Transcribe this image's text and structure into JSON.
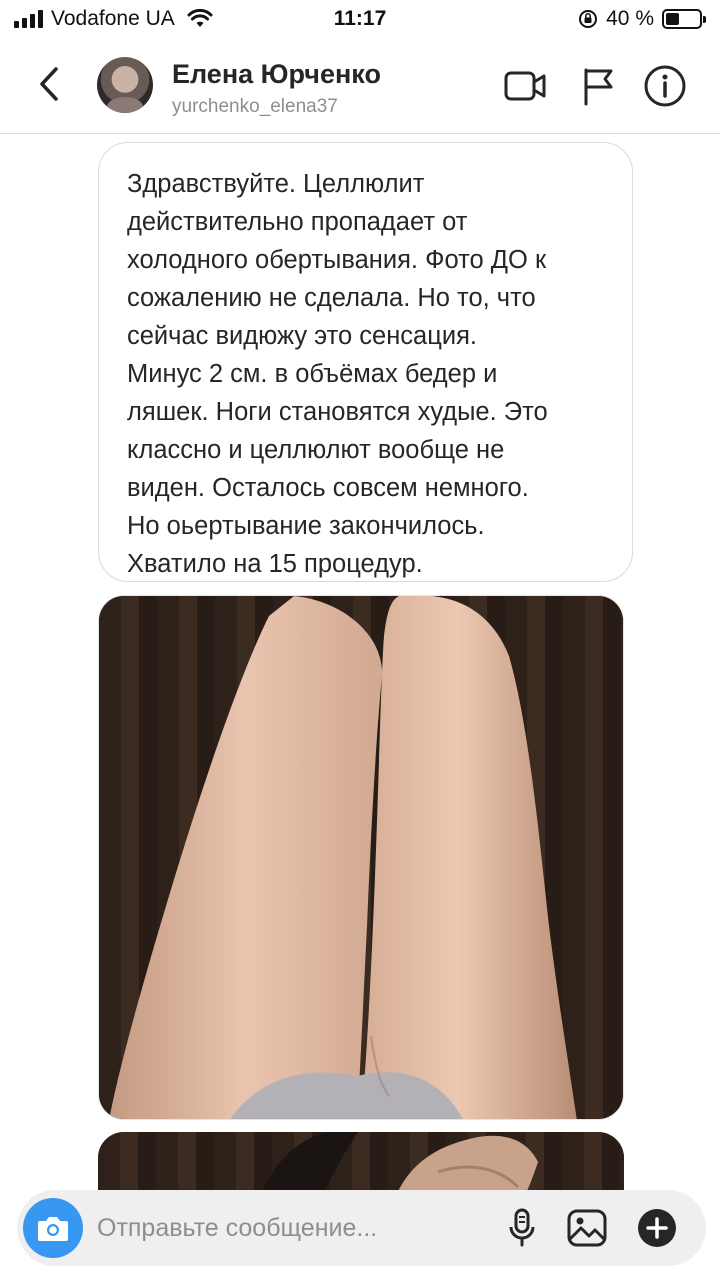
{
  "status_bar": {
    "carrier": "Vodafone UA",
    "time": "11:17",
    "battery_percent": "40 %",
    "battery_level": 0.4
  },
  "header": {
    "name": "Елена Юрченко",
    "username": "yurchenko_elena37",
    "icons": [
      "back-icon",
      "video-call-icon",
      "flag-icon",
      "info-icon"
    ]
  },
  "messages": [
    {
      "type": "text",
      "text": "Здравствуйте. Целлюлит\nдействительно пропадает от\nхолодного обертывания. Фото ДО к\nсожалению не сделала. Но то, что\nсейчас видюжу это сенсация.\nМинус 2 см. в объёмах бедер и\nляшек. Ноги становятся худые. Это\nклассно и целлюлют вообще не\nвиден. Осталось совсем немного.\nНо оьертывание закончилось.\nХватило на 15 процедур."
    },
    {
      "type": "photo"
    },
    {
      "type": "photo"
    }
  ],
  "composer": {
    "placeholder": "Отправьте сообщение...",
    "icons": [
      "camera-icon",
      "microphone-icon",
      "gallery-icon",
      "plus-icon"
    ]
  },
  "colors": {
    "accent": "#3897f0",
    "text": "#262626",
    "secondary_text": "#8e8e8e",
    "border": "#dbdbdb"
  }
}
